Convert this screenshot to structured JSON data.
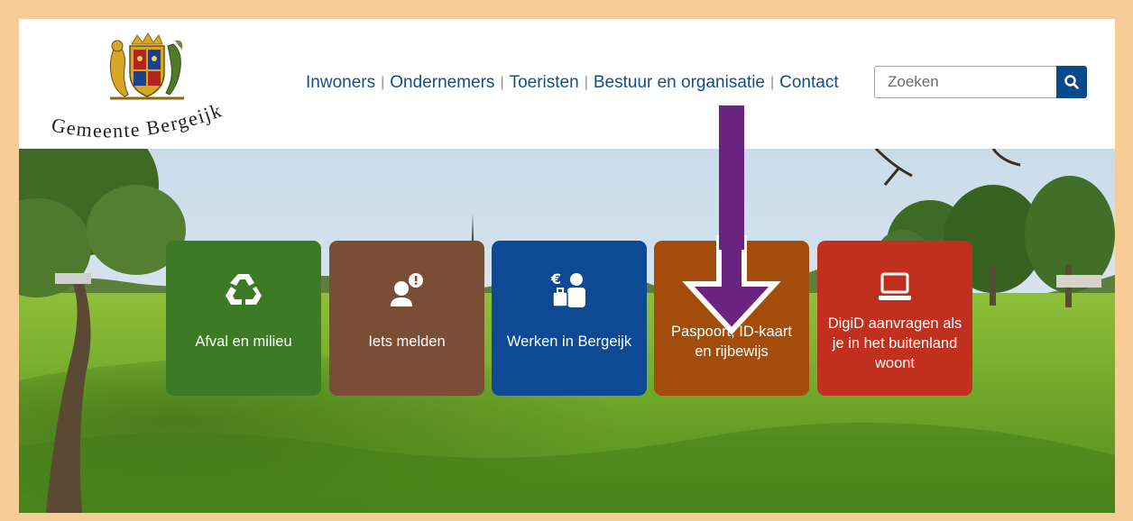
{
  "header": {
    "logo_text": "Gemeente Bergeijk",
    "nav": [
      {
        "label": "Inwoners"
      },
      {
        "label": "Ondernemers"
      },
      {
        "label": "Toeristen"
      },
      {
        "label": "Bestuur en organisatie"
      },
      {
        "label": "Contact"
      }
    ],
    "search": {
      "placeholder": "Zoeken",
      "value": "",
      "button_icon": "search-icon"
    }
  },
  "tiles": [
    {
      "label": "Afval en milieu",
      "icon": "recycle-icon",
      "color": "#3d7a26"
    },
    {
      "label": "Iets melden",
      "icon": "person-alert-icon",
      "color": "#7a4e35"
    },
    {
      "label": "Werken in Bergeijk",
      "icon": "work-euro-icon",
      "color": "#0d4a93"
    },
    {
      "label": "Paspoort, ID-kaart en rijbewijs",
      "icon": "id-card-icon",
      "color": "#a34c0c"
    },
    {
      "label": "DigiD aanvragen als je in het buitenland woont",
      "icon": "laptop-icon",
      "color": "#c12f1e"
    }
  ],
  "annotation": {
    "arrow_color": "#6a2380",
    "points_to": "Paspoort, ID-kaart en rijbewijs"
  }
}
